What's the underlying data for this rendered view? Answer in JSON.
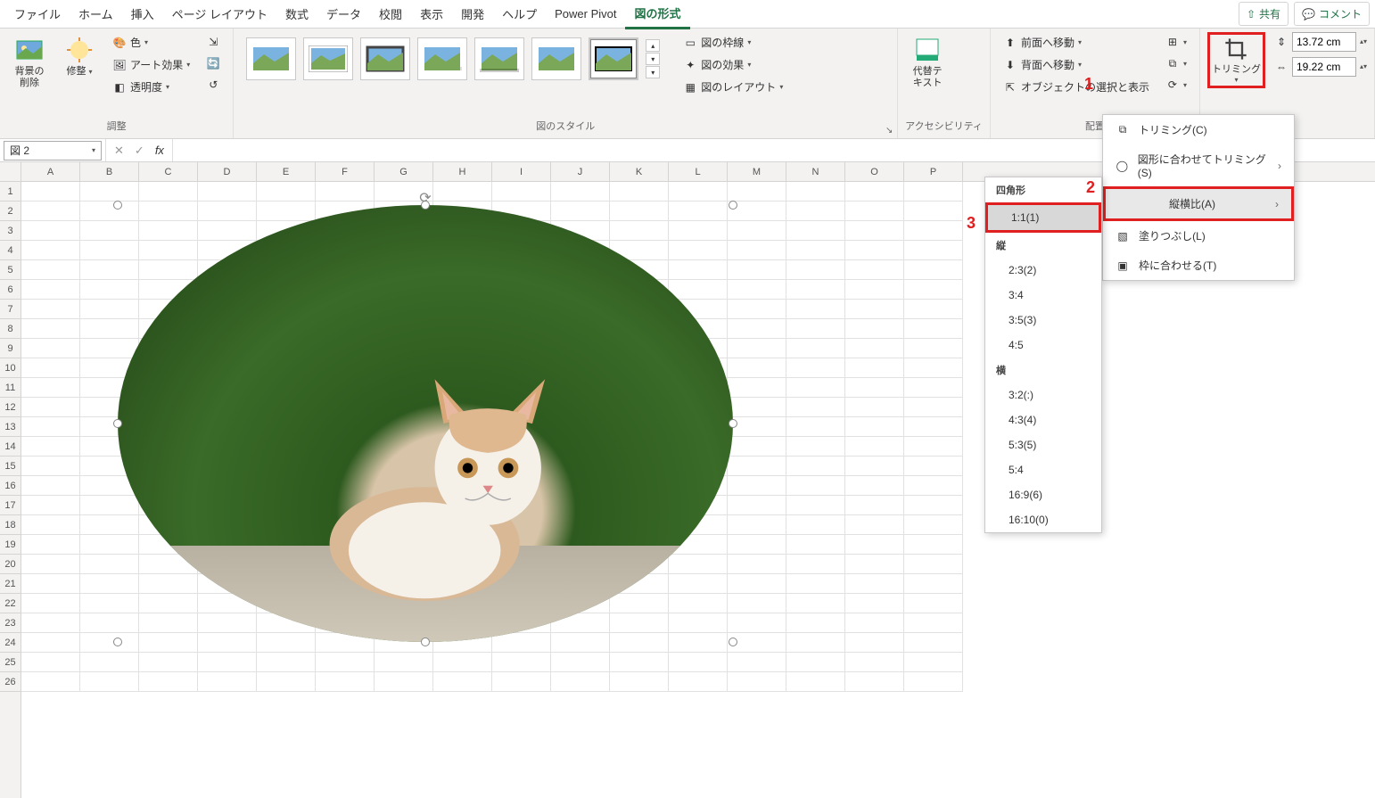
{
  "tabs": {
    "file": "ファイル",
    "home": "ホーム",
    "insert": "挿入",
    "page_layout": "ページ レイアウト",
    "formulas": "数式",
    "data": "データ",
    "review": "校閲",
    "view": "表示",
    "developer": "開発",
    "help": "ヘルプ",
    "power_pivot": "Power Pivot",
    "picture_format": "図の形式"
  },
  "share": "共有",
  "comment": "コメント",
  "ribbon": {
    "remove_bg": "背景の\n削除",
    "corrections": "修整",
    "color": "色",
    "art_effects": "アート効果",
    "transparency": "透明度",
    "group_adjust": "調整",
    "group_styles": "図のスタイル",
    "border": "図の枠線",
    "effects": "図の効果",
    "layout": "図のレイアウト",
    "alt_text": "代替テ\nキスト",
    "group_access": "アクセシビリティ",
    "bring_fwd": "前面へ移動",
    "send_back": "背面へ移動",
    "selection": "オブジェクトの選択と表示",
    "group_arrange": "配置",
    "crop": "トリミング",
    "height": "13.72 cm",
    "width": "19.22 cm"
  },
  "name_box": "図 2",
  "columns": [
    "A",
    "B",
    "C",
    "D",
    "E",
    "F",
    "G",
    "H",
    "I",
    "J",
    "K",
    "L",
    "M",
    "N",
    "O",
    "P"
  ],
  "popup1": {
    "crop": "トリミング(C)",
    "crop_to_shape": "図形に合わせてトリミング(S)",
    "aspect_ratio": "縦横比(A)",
    "fill": "塗りつぶし(L)",
    "fit": "枠に合わせる(T)"
  },
  "popup2": {
    "square_hdr": "四角形",
    "i_1_1": "1:1(1)",
    "vert_hdr": "縦",
    "i_2_3": "2:3(2)",
    "i_3_4": "3:4",
    "i_3_5": "3:5(3)",
    "i_4_5": "4:5",
    "horiz_hdr": "横",
    "i_3_2": "3:2(:)",
    "i_4_3": "4:3(4)",
    "i_5_3": "5:3(5)",
    "i_5_4": "5:4",
    "i_16_9": "16:9(6)",
    "i_16_10": "16:10(0)"
  },
  "annot": {
    "a1": "1",
    "a2": "2",
    "a3": "3"
  }
}
